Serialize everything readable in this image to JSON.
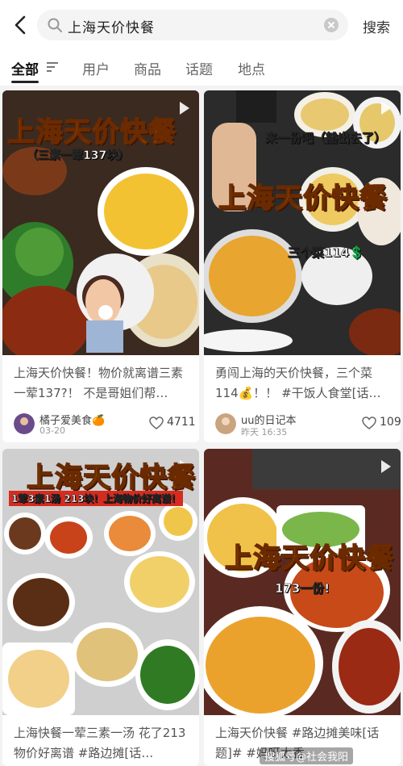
{
  "search": {
    "query": "上海天价快餐",
    "submit_label": "搜索"
  },
  "tabs": [
    {
      "label": "全部"
    },
    {
      "label": "用户"
    },
    {
      "label": "商品"
    },
    {
      "label": "话题"
    },
    {
      "label": "地点"
    }
  ],
  "cards": [
    {
      "overlay_title": "上海天价快餐",
      "overlay_sub": "（三素一荤137块）",
      "caption": "上海天价快餐！物价就离谱三素一荤137?！ 不是哥姐们帮…",
      "author": "橘子爱美食🍊",
      "date": "03-20",
      "likes": "4711"
    },
    {
      "overlay_title": "上海天价快餐",
      "overlay_sub": "来一份吧（豁出去了）",
      "overlay_note": "三个菜114💲",
      "caption": "勇闯上海的天价快餐，三个菜114💰！！ #干饭人食堂[话…",
      "author": "uu的日记本",
      "date": "昨天 16:35",
      "likes": "109"
    },
    {
      "overlay_title": "上海天价快餐",
      "overlay_sub": "1荤3素1汤 213块！上海物价好离谱！",
      "caption": "上海快餐一荤三素一汤 花了213 物价好离谱 #路边摊[话…"
    },
    {
      "overlay_title": "上海天价快餐",
      "overlay_sub": "173一份!",
      "caption": "上海天价快餐 #路边摊美味[话题]# #妈呀太香",
      "watermark": "搜狐号@社会我阳"
    }
  ],
  "colors": {
    "accent": "#ff2442",
    "title_yellow": "#ffe11e"
  }
}
